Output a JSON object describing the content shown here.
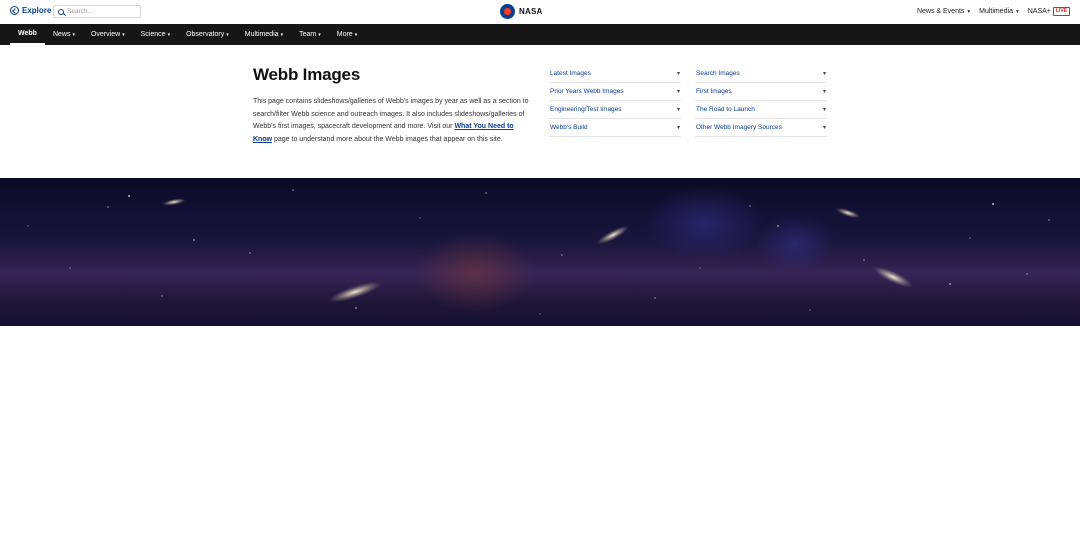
{
  "topbar": {
    "explore_label": "Explore",
    "search_placeholder": "Search...",
    "brand": "NASA",
    "links": [
      {
        "label": "News & Events",
        "caret": "▾"
      },
      {
        "label": "Multimedia",
        "caret": "▾"
      },
      {
        "label": "NASA+",
        "badge": "LIVE"
      }
    ]
  },
  "nav": {
    "items": [
      {
        "label": "Webb",
        "caret": ""
      },
      {
        "label": "News",
        "caret": "▾"
      },
      {
        "label": "Overview",
        "caret": "▾"
      },
      {
        "label": "Science",
        "caret": "▾"
      },
      {
        "label": "Observatory",
        "caret": "▾"
      },
      {
        "label": "Multimedia",
        "caret": "▾"
      },
      {
        "label": "Team",
        "caret": "▾"
      },
      {
        "label": "More",
        "caret": "▾"
      }
    ]
  },
  "main": {
    "title": "Webb Images",
    "intro_text_1": "This page contains slideshows/galleries of Webb's images by year as well as a section to search/filter Webb science and outreach images. It also includes slideshows/galleries of Webb's first images, spacecraft development and more. Visit our ",
    "intro_link": "What You Need to Know",
    "intro_text_2": " page to understand more about the Webb images that appear on this site.",
    "links_left": [
      {
        "label": "Latest Images",
        "caret": "▾"
      },
      {
        "label": "Prior Years Webb Images",
        "caret": "▾"
      },
      {
        "label": "Engineering/Test Images",
        "caret": "▾"
      },
      {
        "label": "Webb's Build",
        "caret": "▾"
      }
    ],
    "links_right": [
      {
        "label": "Search Images",
        "caret": "▾"
      },
      {
        "label": "First Images",
        "caret": "▾"
      },
      {
        "label": "The Road to Launch",
        "caret": "▾"
      },
      {
        "label": "Other Webb Imagery Sources",
        "caret": "▾"
      }
    ]
  },
  "colors": {
    "accent": "#0b3d91",
    "nav_bg": "#161616",
    "live": "#e0261b",
    "hero_bg": "#181640"
  },
  "icons": {
    "explore": "explore-icon",
    "search": "search-icon",
    "logo": "nasa-logo"
  }
}
